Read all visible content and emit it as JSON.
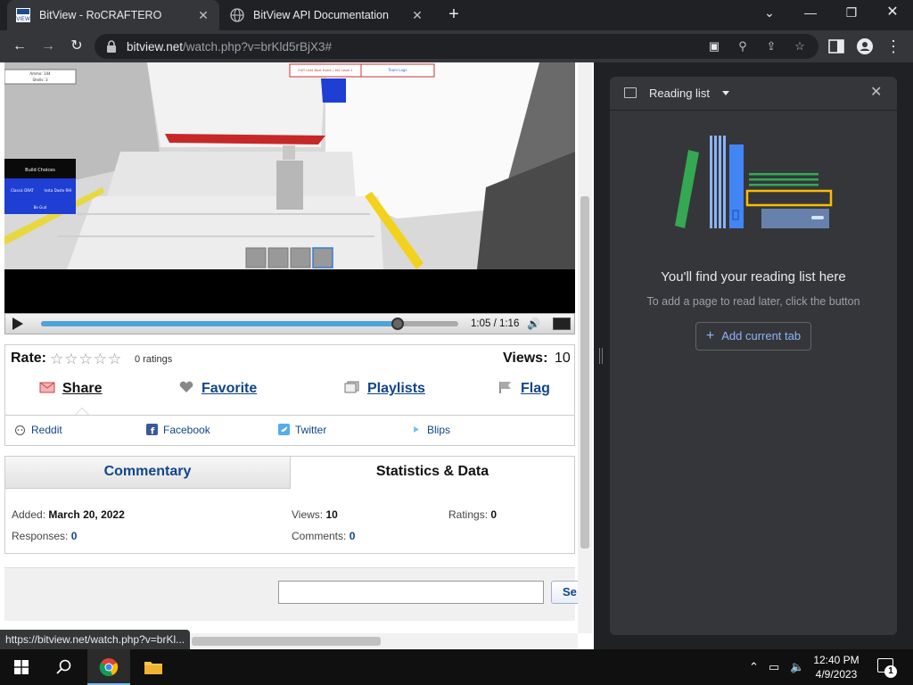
{
  "browser": {
    "tabs": [
      {
        "title": "BitView - RoCRAFTERO",
        "active": true
      },
      {
        "title": "BitView API Documentation",
        "active": false
      }
    ],
    "url_host": "bitview.net",
    "url_path": "/watch.php?v=brKld5rBjX3#",
    "status_url": "https://bitview.net/watch.php?v=brKl..."
  },
  "player": {
    "time": "1:05 / 1:16",
    "progress": 0.855,
    "overlay": {
      "ammo": "Ammo: 144",
      "shells": "Shells: 3",
      "build": "Build Choices",
      "red_label": "EXIT Until Next Event | 162 Level 1",
      "teams": "Team Logs",
      "left_btn": "Classic DRAT",
      "right_btn": "Insta Daste RHI",
      "bottom_btn": "Be Gud"
    }
  },
  "rating": {
    "label": "Rate:",
    "stars": "☆☆☆☆☆",
    "ratings_text": "0 ratings",
    "views_label": "Views:",
    "views_value": "10"
  },
  "actions": {
    "share": "Share",
    "favorite": "Favorite",
    "playlists": "Playlists",
    "flag": "Flag"
  },
  "social": {
    "reddit": "Reddit",
    "facebook": "Facebook",
    "twitter": "Twitter",
    "blips": "Blips"
  },
  "info_tabs": {
    "commentary": "Commentary",
    "statistics": "Statistics & Data"
  },
  "stats": {
    "added_label": "Added:",
    "added_value": "March 20, 2022",
    "views_label": "Views:",
    "views_value": "10",
    "ratings_label": "Ratings:",
    "ratings_value": "0",
    "responses_label": "Responses:",
    "responses_value": "0",
    "comments_label": "Comments:",
    "comments_value": "0"
  },
  "search": {
    "button": "Se"
  },
  "reading_list": {
    "header": "Reading list",
    "title": "You'll find your reading list here",
    "subtitle": "To add a page to read later, click the button",
    "button": "Add current tab"
  },
  "taskbar": {
    "time": "12:40 PM",
    "date": "4/9/2023",
    "notifications": "1"
  },
  "colors": {
    "link": "#11458a",
    "chrome_dark": "#202124",
    "chrome_toolbar": "#35363a",
    "accent_blue": "#8ab4f8"
  }
}
